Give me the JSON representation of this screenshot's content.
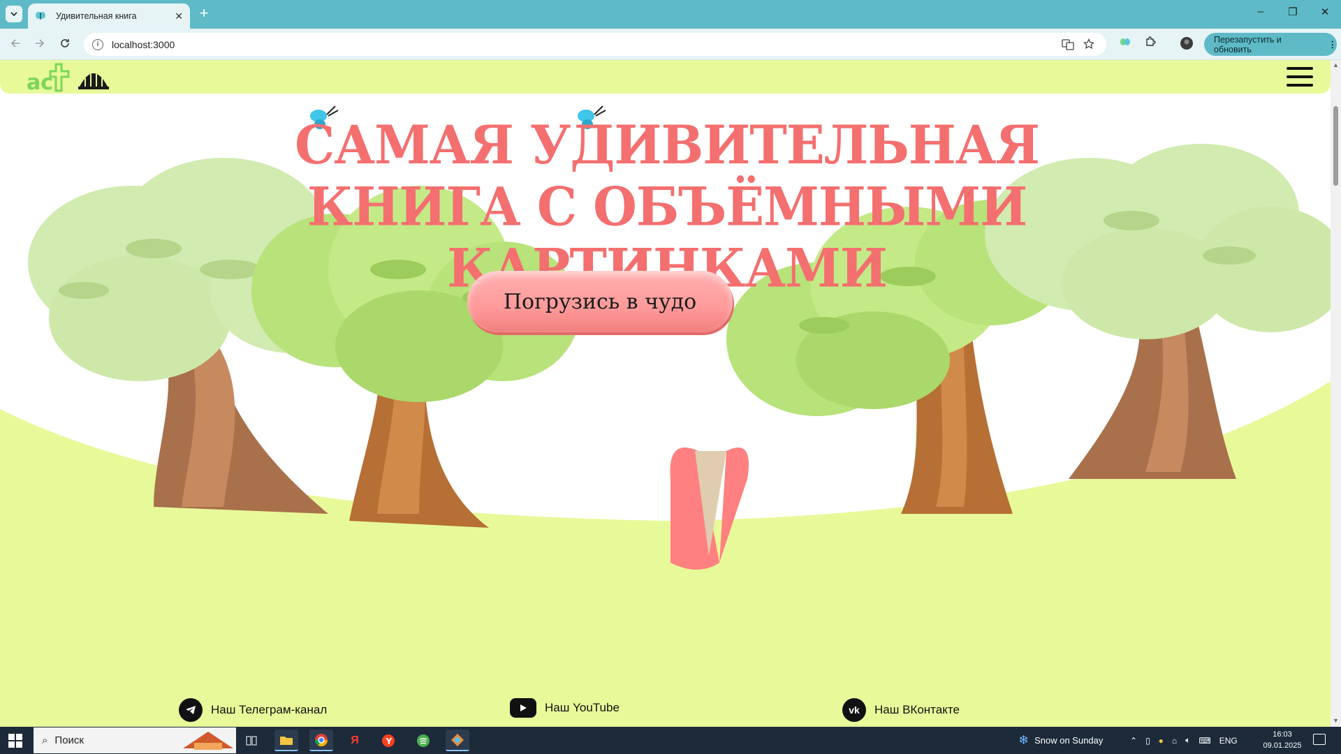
{
  "browser": {
    "tab_title": "Удивительная книга",
    "tab_close": "✕",
    "new_tab": "+",
    "url": "localhost:3000",
    "relaunch_label": "Перезапустить и обновить",
    "window_minimize": "–",
    "window_restore": "❐",
    "window_close": "✕"
  },
  "hero": {
    "title": "Самая удивительная книга с объёмными картинками",
    "cta_label": "Погрузись в чудо"
  },
  "footer": {
    "telegram_label": "Наш Телеграм-канал",
    "youtube_label": "Наш YouTube",
    "vk_label": "Наш ВКонтакте",
    "vk_icon_text": "vk"
  },
  "taskbar": {
    "search_placeholder": "Поиск",
    "weather": "Snow on Sunday",
    "lang": "ENG",
    "time": "16:03",
    "date": "09.01.2025"
  },
  "colors": {
    "tab_strip": "#5ebac6",
    "header_bg": "#e8f999",
    "title_color": "#f46f6f",
    "cta_bg": "#ff9a9a"
  }
}
